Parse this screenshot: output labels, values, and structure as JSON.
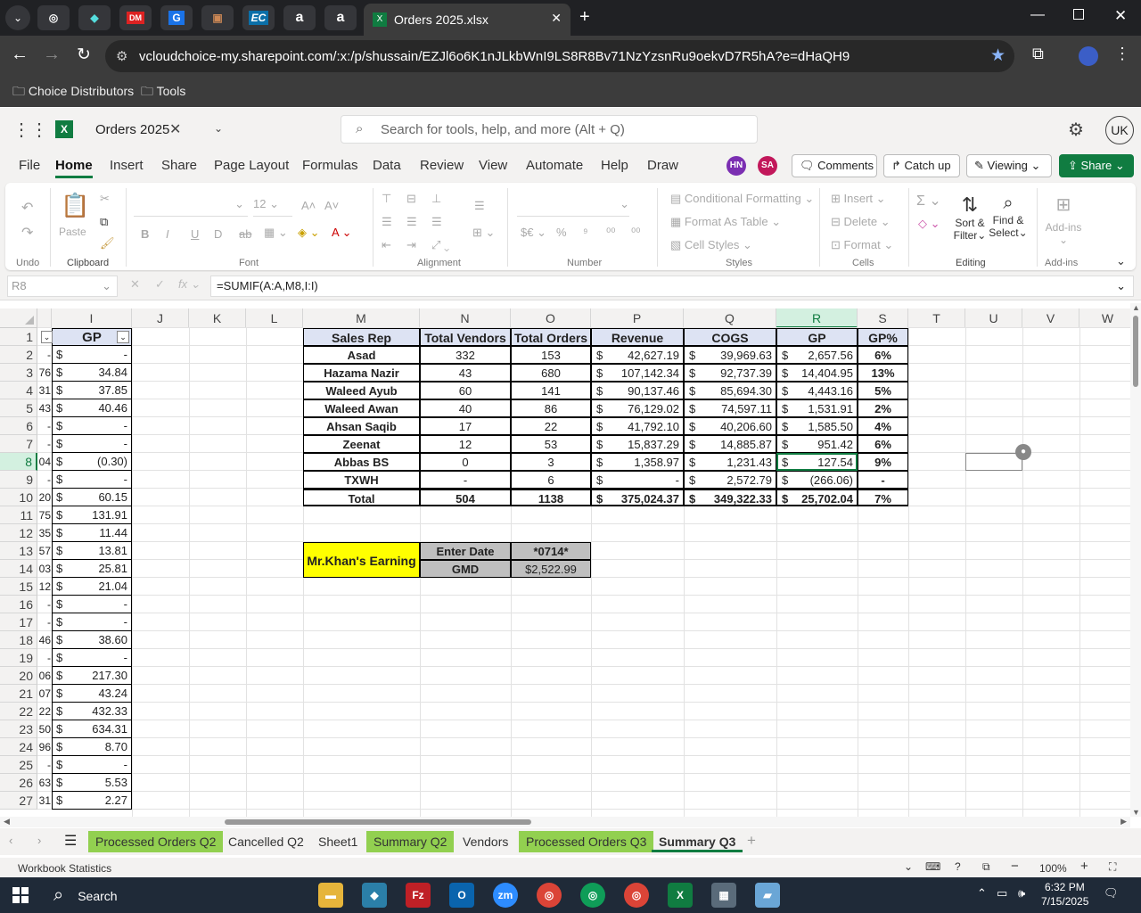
{
  "browser": {
    "tab_title": "Orders 2025.xlsx",
    "url": "vcloudchoice-my.sharepoint.com/:x:/p/shussain/EZJl6o6K1nJLkbWnI9LS8R8Bv71NzYzsnRu9oekvD7R5hA?e=dHaQH9",
    "bookmarks": [
      "Choice Distributors",
      "Tools"
    ],
    "pinned_tabs": [
      "chrome-icon",
      "app-icon",
      "pdf-icon",
      "g-icon",
      "box-icon",
      "EC",
      "a",
      "a"
    ]
  },
  "excel": {
    "file_name": "Orders 2025",
    "search_placeholder": "Search for tools, help, and more (Alt + Q)",
    "account": "UK",
    "menu": [
      "File",
      "Home",
      "Insert",
      "Share",
      "Page Layout",
      "Formulas",
      "Data",
      "Review",
      "View",
      "Automate",
      "Help",
      "Draw"
    ],
    "active_menu": "Home",
    "collaborators": [
      "HN",
      "SA"
    ],
    "buttons": {
      "comments": "Comments",
      "catch_up": "Catch up",
      "viewing": "Viewing",
      "share": "Share"
    },
    "ribbon": {
      "undo_group": "Undo",
      "clipboard": {
        "label": "Clipboard",
        "paste": "Paste"
      },
      "font": {
        "label": "Font",
        "size": "12"
      },
      "alignment": "Alignment",
      "number": "Number",
      "styles": {
        "label": "Styles",
        "conditional": "Conditional Formatting",
        "format_table": "Format As Table",
        "cell_styles": "Cell Styles"
      },
      "cells": {
        "label": "Cells",
        "insert": "Insert",
        "delete": "Delete",
        "format": "Format"
      },
      "editing": {
        "label": "Editing",
        "sort": "Sort &",
        "filter": "Filter",
        "find": "Find &",
        "select": "Select"
      },
      "addins": {
        "label": "Add-ins",
        "name": "Add-ins"
      }
    },
    "name_box": "R8",
    "formula": "=SUMIF(A:A,M8,I:I)",
    "columns": [
      "I",
      "J",
      "K",
      "L",
      "M",
      "N",
      "O",
      "P",
      "Q",
      "R",
      "S",
      "T",
      "U",
      "V",
      "W"
    ],
    "rows": [
      "1",
      "2",
      "3",
      "4",
      "5",
      "6",
      "7",
      "8",
      "9",
      "10",
      "11",
      "12",
      "13",
      "14",
      "15",
      "16",
      "17",
      "18",
      "19",
      "20",
      "21",
      "22",
      "23",
      "24",
      "25",
      "26",
      "27"
    ],
    "col_h_cut": [
      "",
      "-",
      "76",
      "31",
      "43",
      "-",
      "-",
      "04",
      "-",
      "20",
      "75",
      "35",
      "57",
      "03",
      "12",
      "-",
      "-",
      "46",
      "-",
      "06",
      "07",
      "22",
      "50",
      "96",
      "-",
      "63",
      "31"
    ],
    "col_i_header": "GP",
    "col_i": [
      "-",
      "34.84",
      "37.85",
      "40.46",
      "-",
      "-",
      "(0.30)",
      "-",
      "60.15",
      "131.91",
      "11.44",
      "13.81",
      "25.81",
      "21.04",
      "-",
      "-",
      "38.60",
      "-",
      "217.30",
      "43.24",
      "432.33",
      "634.31",
      "8.70",
      "-",
      "5.53",
      "2.27"
    ],
    "summary_headers": [
      "Sales Rep",
      "Total Vendors",
      "Total Orders",
      "Revenue",
      "COGS",
      "GP",
      "GP%"
    ],
    "summary_rows": [
      [
        "Asad",
        "332",
        "153",
        "42,627.19",
        "39,969.63",
        "2,657.56",
        "6%"
      ],
      [
        "Hazama Nazir",
        "43",
        "680",
        "107,142.34",
        "92,737.39",
        "14,404.95",
        "13%"
      ],
      [
        "Waleed Ayub",
        "60",
        "141",
        "90,137.46",
        "85,694.30",
        "4,443.16",
        "5%"
      ],
      [
        "Waleed Awan",
        "40",
        "86",
        "76,129.02",
        "74,597.11",
        "1,531.91",
        "2%"
      ],
      [
        "Ahsan Saqib",
        "17",
        "22",
        "41,792.10",
        "40,206.60",
        "1,585.50",
        "4%"
      ],
      [
        "Zeenat",
        "12",
        "53",
        "15,837.29",
        "14,885.87",
        "951.42",
        "6%"
      ],
      [
        "Abbas BS",
        "0",
        "3",
        "1,358.97",
        "1,231.43",
        "127.54",
        "9%"
      ],
      [
        "TXWH",
        "-",
        "6",
        "-",
        "2,572.79",
        "(266.06)",
        "-"
      ]
    ],
    "summary_total": [
      "Total",
      "504",
      "1138",
      "375,024.37",
      "349,322.33",
      "25,702.04",
      "7%"
    ],
    "currency": "$",
    "earning": {
      "label": "Mr.Khan's Earning",
      "date_label": "Enter Date",
      "date_value": "*0714*",
      "gmd_label": "GMD",
      "gmd_value": "$2,522.99"
    },
    "sheet_tabs": [
      {
        "name": "Processed Orders Q2",
        "green": true
      },
      {
        "name": "Cancelled Q2",
        "green": false
      },
      {
        "name": "Sheet1",
        "green": false
      },
      {
        "name": "Summary Q2",
        "green": true
      },
      {
        "name": "Vendors",
        "green": false
      },
      {
        "name": "Processed Orders Q3",
        "green": true
      },
      {
        "name": "Summary Q3",
        "green": false,
        "active": true
      }
    ],
    "status_left": "Workbook Statistics",
    "zoom": "100%"
  },
  "taskbar": {
    "search": "Search",
    "time": "6:32 PM",
    "date": "7/15/2025"
  },
  "colors": {
    "yellow": "#ffff00",
    "summary_header_bg": "#dde3f3",
    "green_tab": "#92d050",
    "excel_green": "#107c41"
  }
}
